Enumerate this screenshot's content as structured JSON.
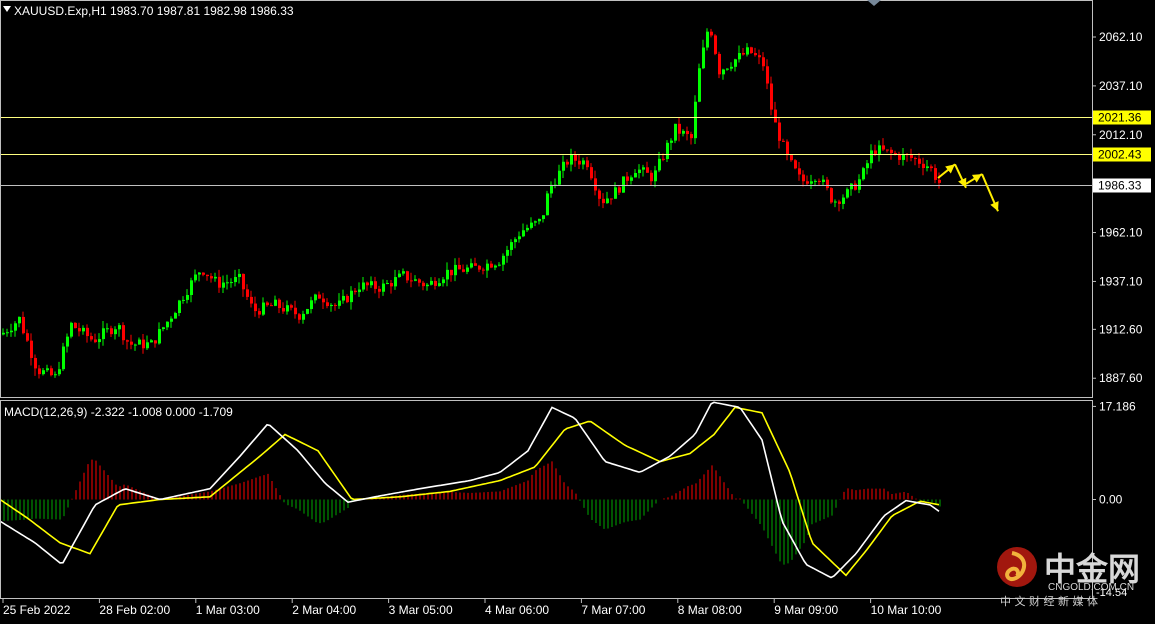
{
  "chart_data": {
    "type": "candlestick",
    "symbol_header": "XAUUSD.Exp,H1  1983.70 1987.81 1982.98 1986.33",
    "price_axis": {
      "ticks": [
        {
          "value": 2062.1,
          "label": "2062.10"
        },
        {
          "value": 2037.1,
          "label": "2037.10"
        },
        {
          "value": 2012.1,
          "label": "2012.10"
        },
        {
          "value": 1962.1,
          "label": "1962.10"
        },
        {
          "value": 1937.1,
          "label": "1937.10"
        },
        {
          "value": 1912.6,
          "label": "1912.60"
        },
        {
          "value": 1887.6,
          "label": "1887.60"
        }
      ],
      "range": [
        1878,
        2080
      ]
    },
    "levels": [
      {
        "value": 2021.36,
        "label": "2021.36",
        "color": "#ffff80",
        "label_bg": "#ffff00"
      },
      {
        "value": 2002.43,
        "label": "2002.43",
        "color": "#ffff80",
        "label_bg": "#ffff00"
      },
      {
        "value": 1986.33,
        "label": "1986.33",
        "color": "#c0c0c0",
        "label_bg": "#ffffff"
      }
    ],
    "time_axis": [
      "25 Feb 2022",
      "28 Feb 02:00",
      "1 Mar 03:00",
      "2 Mar 04:00",
      "3 Mar 05:00",
      "4 Mar 06:00",
      "7 Mar 07:00",
      "8 Mar 08:00",
      "9 Mar 09:00",
      "10 Mar 10:00"
    ],
    "path_anchors": [
      {
        "t": 0,
        "p": 1910
      },
      {
        "t": 18,
        "p": 1918
      },
      {
        "t": 36,
        "p": 1892
      },
      {
        "t": 54,
        "p": 1888
      },
      {
        "t": 70,
        "p": 1915
      },
      {
        "t": 92,
        "p": 1907
      },
      {
        "t": 116,
        "p": 1915
      },
      {
        "t": 128,
        "p": 1905
      },
      {
        "t": 150,
        "p": 1905
      },
      {
        "t": 168,
        "p": 1918
      },
      {
        "t": 182,
        "p": 1930
      },
      {
        "t": 200,
        "p": 1944
      },
      {
        "t": 216,
        "p": 1936
      },
      {
        "t": 238,
        "p": 1938
      },
      {
        "t": 252,
        "p": 1922
      },
      {
        "t": 274,
        "p": 1925
      },
      {
        "t": 298,
        "p": 1920
      },
      {
        "t": 318,
        "p": 1930
      },
      {
        "t": 336,
        "p": 1924
      },
      {
        "t": 358,
        "p": 1935
      },
      {
        "t": 380,
        "p": 1934
      },
      {
        "t": 402,
        "p": 1940
      },
      {
        "t": 426,
        "p": 1935
      },
      {
        "t": 446,
        "p": 1942
      },
      {
        "t": 474,
        "p": 1944
      },
      {
        "t": 498,
        "p": 1948
      },
      {
        "t": 520,
        "p": 1963
      },
      {
        "t": 540,
        "p": 1968
      },
      {
        "t": 548,
        "p": 1985
      },
      {
        "t": 568,
        "p": 2000
      },
      {
        "t": 586,
        "p": 1998
      },
      {
        "t": 600,
        "p": 1978
      },
      {
        "t": 614,
        "p": 1983
      },
      {
        "t": 634,
        "p": 1995
      },
      {
        "t": 652,
        "p": 1990
      },
      {
        "t": 664,
        "p": 2004
      },
      {
        "t": 674,
        "p": 2015
      },
      {
        "t": 690,
        "p": 2010
      },
      {
        "t": 698,
        "p": 2045
      },
      {
        "t": 708,
        "p": 2070
      },
      {
        "t": 718,
        "p": 2045
      },
      {
        "t": 732,
        "p": 2050
      },
      {
        "t": 748,
        "p": 2055
      },
      {
        "t": 762,
        "p": 2048
      },
      {
        "t": 772,
        "p": 2020
      },
      {
        "t": 786,
        "p": 2000
      },
      {
        "t": 800,
        "p": 1988
      },
      {
        "t": 816,
        "p": 1992
      },
      {
        "t": 832,
        "p": 1978
      },
      {
        "t": 846,
        "p": 1982
      },
      {
        "t": 860,
        "p": 1990
      },
      {
        "t": 872,
        "p": 2005
      },
      {
        "t": 892,
        "p": 2002
      },
      {
        "t": 912,
        "p": 2000
      },
      {
        "t": 928,
        "p": 1996
      },
      {
        "t": 940,
        "p": 1986
      }
    ],
    "forecast_arrows": [
      {
        "from": [
          938,
          1990
        ],
        "to": [
          955,
          1997
        ]
      },
      {
        "from": [
          955,
          1997
        ],
        "to": [
          966,
          1985
        ]
      },
      {
        "from": [
          966,
          1987
        ],
        "to": [
          982,
          1992
        ]
      },
      {
        "from": [
          982,
          1992
        ],
        "to": [
          998,
          1973
        ]
      }
    ],
    "macd": {
      "header": "MACD(12,26,9) -2.322 -1.008 0.000 -1.709",
      "ticks": [
        {
          "value": 17.186,
          "label": "17.186"
        },
        {
          "value": 0.0,
          "label": "0.00"
        }
      ],
      "cut_label": "-14.54",
      "range": [
        -18,
        18
      ],
      "main_anchors": [
        {
          "t": 0,
          "v": -4
        },
        {
          "t": 35,
          "v": -8
        },
        {
          "t": 62,
          "v": -12
        },
        {
          "t": 95,
          "v": -1
        },
        {
          "t": 125,
          "v": 2
        },
        {
          "t": 160,
          "v": 0
        },
        {
          "t": 210,
          "v": 2
        },
        {
          "t": 240,
          "v": 8
        },
        {
          "t": 268,
          "v": 14
        },
        {
          "t": 298,
          "v": 9
        },
        {
          "t": 325,
          "v": 3
        },
        {
          "t": 348,
          "v": -0.5
        },
        {
          "t": 375,
          "v": 0.5
        },
        {
          "t": 420,
          "v": 2
        },
        {
          "t": 470,
          "v": 3.5
        },
        {
          "t": 500,
          "v": 5
        },
        {
          "t": 528,
          "v": 9
        },
        {
          "t": 552,
          "v": 17
        },
        {
          "t": 575,
          "v": 15
        },
        {
          "t": 605,
          "v": 7
        },
        {
          "t": 640,
          "v": 5
        },
        {
          "t": 670,
          "v": 8
        },
        {
          "t": 695,
          "v": 12
        },
        {
          "t": 712,
          "v": 18
        },
        {
          "t": 740,
          "v": 17
        },
        {
          "t": 762,
          "v": 11
        },
        {
          "t": 782,
          "v": -4
        },
        {
          "t": 806,
          "v": -12
        },
        {
          "t": 832,
          "v": -14.5
        },
        {
          "t": 856,
          "v": -10
        },
        {
          "t": 884,
          "v": -3
        },
        {
          "t": 906,
          "v": -0.2
        },
        {
          "t": 930,
          "v": -1
        },
        {
          "t": 940,
          "v": -2.3
        }
      ],
      "signal_anchors": [
        {
          "t": 0,
          "v": 0
        },
        {
          "t": 28,
          "v": -3.5
        },
        {
          "t": 60,
          "v": -8
        },
        {
          "t": 90,
          "v": -10
        },
        {
          "t": 118,
          "v": -1
        },
        {
          "t": 160,
          "v": 0
        },
        {
          "t": 210,
          "v": 0.5
        },
        {
          "t": 260,
          "v": 8
        },
        {
          "t": 285,
          "v": 12
        },
        {
          "t": 318,
          "v": 9
        },
        {
          "t": 352,
          "v": 0
        },
        {
          "t": 400,
          "v": 0.5
        },
        {
          "t": 450,
          "v": 1.5
        },
        {
          "t": 500,
          "v": 3.5
        },
        {
          "t": 535,
          "v": 6
        },
        {
          "t": 565,
          "v": 13
        },
        {
          "t": 590,
          "v": 14.5
        },
        {
          "t": 625,
          "v": 10
        },
        {
          "t": 660,
          "v": 7
        },
        {
          "t": 690,
          "v": 8.5
        },
        {
          "t": 714,
          "v": 12
        },
        {
          "t": 735,
          "v": 17
        },
        {
          "t": 762,
          "v": 16
        },
        {
          "t": 790,
          "v": 5
        },
        {
          "t": 812,
          "v": -8
        },
        {
          "t": 846,
          "v": -14
        },
        {
          "t": 868,
          "v": -9
        },
        {
          "t": 892,
          "v": -3
        },
        {
          "t": 920,
          "v": -0.3
        },
        {
          "t": 940,
          "v": -1.0
        }
      ]
    },
    "colors": {
      "bull": "#00ff00",
      "bear": "#ff0000",
      "macd_main": "#ffffff",
      "macd_signal": "#ffff00",
      "hist_pos": "#ff0000",
      "hist_neg": "#00aa00",
      "panel_border": "#c0c0c0"
    }
  },
  "watermark": {
    "brand": "中金网",
    "sub": "CNGOLD.COM.CN",
    "tagline": "中 文 财 经 新 媒 体"
  }
}
